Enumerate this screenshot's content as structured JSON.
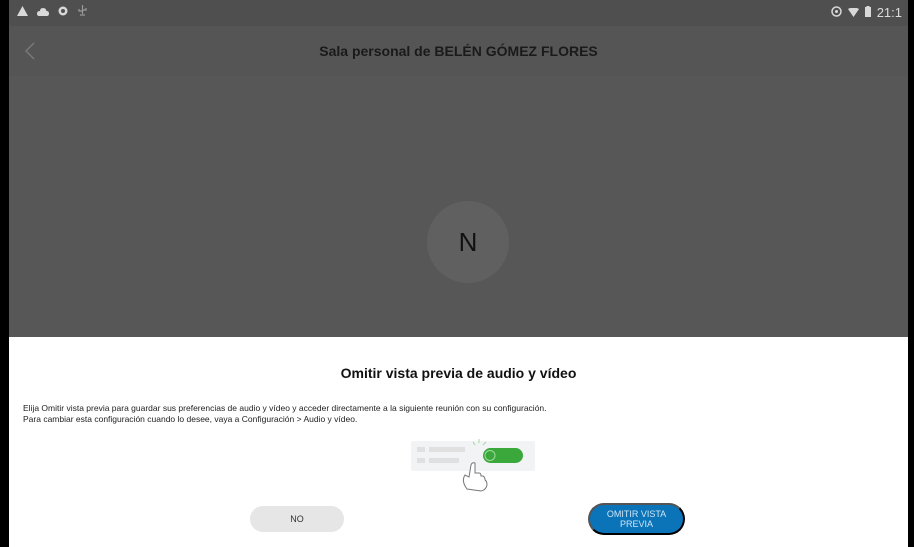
{
  "status_bar": {
    "time": "21:1",
    "left_icons": [
      "warning-icon",
      "cloud-icon",
      "record-icon",
      "usb-icon"
    ],
    "right_icons": [
      "sync-icon",
      "wifi-icon",
      "battery-icon"
    ]
  },
  "app_bar": {
    "title": "Sala personal de BELÉN GÓMEZ FLORES",
    "back_icon": "chevron-left-icon"
  },
  "preview": {
    "avatar_initial": "N"
  },
  "dialog": {
    "title": "Omitir vista previa de audio y vídeo",
    "line1": "Elija Omitir vista previa para guardar sus preferencias de audio y vídeo y acceder directamente a la siguiente reunión con su configuración.",
    "line2": "Para cambiar esta configuración cuando lo desee, vaya a Configuración > Audio y vídeo.",
    "no_label": "NO",
    "skip_label": "OMITIR VISTA\nPREVIA"
  },
  "colors": {
    "accent": "#0b73b8",
    "toggle_green": "#3aa83a",
    "overlay_gray": "#575757"
  }
}
